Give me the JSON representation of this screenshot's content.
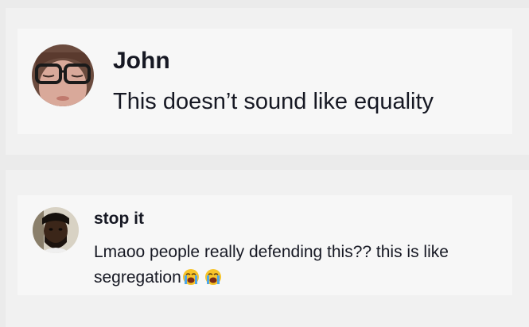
{
  "comments": [
    {
      "username": "John",
      "text": "This doesn’t sound like equality",
      "avatar_icon": "profile-photo-glasses"
    },
    {
      "username": "stop it",
      "text_line1": "Lmaoo people really defending this?? this is like",
      "text_line2": "segregation",
      "emojis": [
        "loudly-crying-face-icon",
        "loudly-crying-face-icon"
      ],
      "avatar_icon": "profile-photo"
    }
  ],
  "colors": {
    "background": "#ebebeb",
    "panel": "#f1f1f1",
    "comment_card": "#f7f7f7",
    "text": "#161823"
  }
}
